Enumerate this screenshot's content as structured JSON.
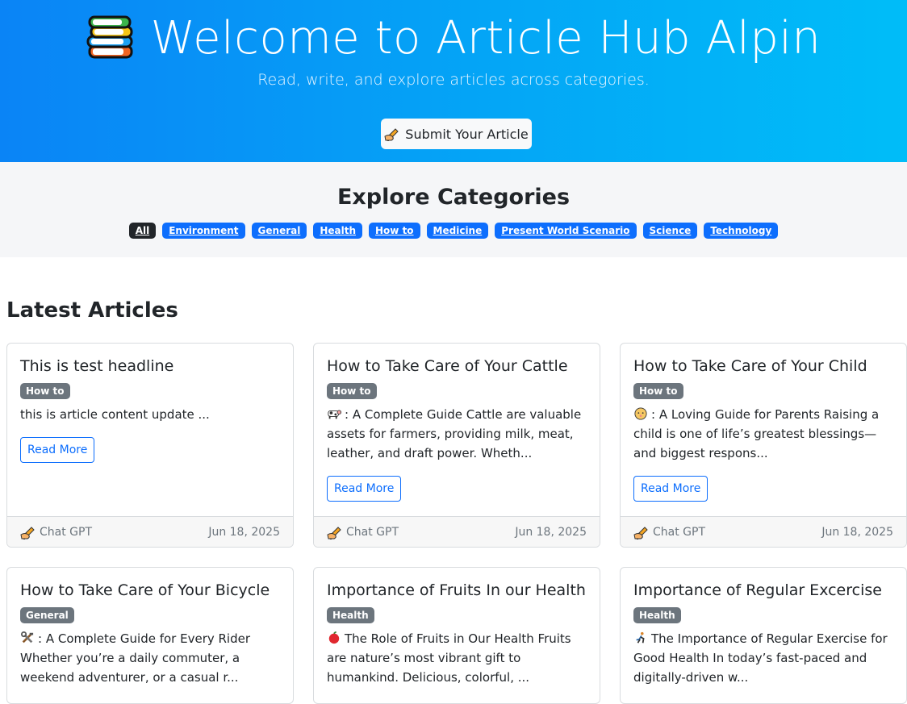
{
  "hero": {
    "title": "Welcome to Article Hub Alpin",
    "subtitle": "Read, write, and explore articles across categories.",
    "submit_label": "Submit Your Article",
    "icon": "books-icon"
  },
  "categories": {
    "heading": "Explore Categories",
    "items": [
      {
        "label": "All",
        "active": true
      },
      {
        "label": "Environment"
      },
      {
        "label": "General"
      },
      {
        "label": "Health"
      },
      {
        "label": "How to"
      },
      {
        "label": "Medicine"
      },
      {
        "label": "Present World Scenario"
      },
      {
        "label": "Science"
      },
      {
        "label": "Technology"
      }
    ]
  },
  "latest_heading": "Latest Articles",
  "articles": [
    {
      "title": "This is test headline",
      "category": "How to",
      "excerpt": "this is article content update ...",
      "icon": "",
      "read_more": "Read More",
      "author": "Chat GPT",
      "date": "Jun 18, 2025"
    },
    {
      "title": "How to Take Care of Your Cattle",
      "category": "How to",
      "excerpt": ": A Complete Guide Cattle are valuable assets for farmers, providing milk, meat, leather, and draft power. Wheth...",
      "icon": "cow-icon",
      "read_more": "Read More",
      "author": "Chat GPT",
      "date": "Jun 18, 2025"
    },
    {
      "title": "How to Take Care of Your Child",
      "category": "How to",
      "excerpt": ": A Loving Guide for Parents Raising a child is one of life’s greatest blessings—and biggest respons...",
      "icon": "baby-icon",
      "read_more": "Read More",
      "author": "Chat GPT",
      "date": "Jun 18, 2025"
    },
    {
      "title": "How to Take Care of Your Bicycle",
      "category": "General",
      "excerpt": ": A Complete Guide for Every Rider Whether you’re a daily commuter, a weekend adventurer, or a casual r...",
      "icon": "tools-icon"
    },
    {
      "title": "Importance of Fruits In our Health",
      "category": "Health",
      "excerpt": "The Role of Fruits in Our Health Fruits are nature’s most vibrant gift to humankind. Delicious, colorful, ...",
      "icon": "apple-icon"
    },
    {
      "title": "Importance of Regular Excercise",
      "category": "Health",
      "excerpt": "The Importance of Regular Exercise for Good Health In today’s fast-paced and digitally-driven w...",
      "icon": "runner-icon"
    }
  ],
  "colors": {
    "primary": "#0d6efd",
    "dark": "#212529",
    "secondary": "#6c757d"
  }
}
